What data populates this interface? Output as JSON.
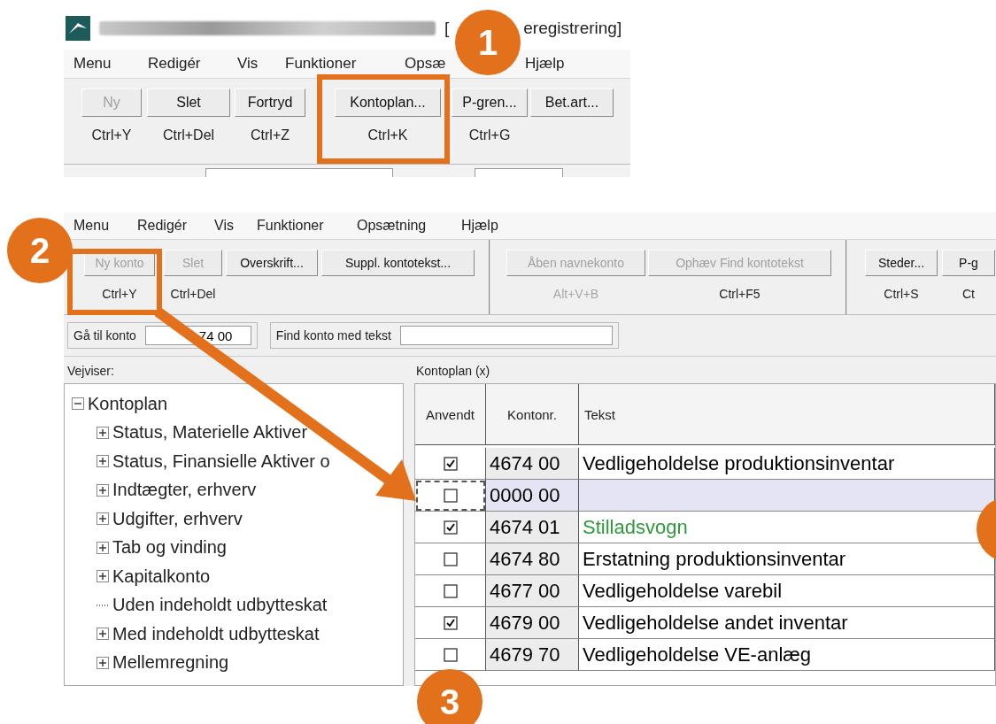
{
  "top_window": {
    "title_start": "[",
    "title_end": "eregistrering]",
    "menu": [
      "Menu",
      "Redigér",
      "Vis",
      "Funktioner",
      "Opsæ",
      "Hjælp"
    ],
    "toolbar": [
      {
        "label": "Ny",
        "disabled": true,
        "shortcut": {
          "text": "Ctrl+Y",
          "disabled": false
        }
      },
      {
        "label": "Slet",
        "disabled": false,
        "shortcut": {
          "text": "Ctrl+Del",
          "disabled": false
        }
      },
      {
        "label": "Fortryd",
        "disabled": false,
        "shortcut": {
          "text": "Ctrl+Z",
          "disabled": false
        }
      },
      {
        "label": "Kontoplan...",
        "disabled": false,
        "shortcut": {
          "text": "Ctrl+K",
          "disabled": false
        }
      },
      {
        "label": "P-gren...",
        "disabled": false,
        "shortcut": {
          "text": "Ctrl+G",
          "disabled": false
        }
      },
      {
        "label": "Bet.art...",
        "disabled": false
      }
    ]
  },
  "main_window": {
    "menu": [
      "Menu",
      "Redigér",
      "Vis",
      "Funktioner",
      "Opsætning",
      "Hjælp"
    ],
    "toolbar_groups": [
      [
        {
          "label": "Ny konto",
          "disabled": true,
          "shortcut": {
            "text": "Ctrl+Y",
            "disabled": false
          }
        },
        {
          "label": "Slet",
          "disabled": true,
          "shortcut": {
            "text": "Ctrl+Del",
            "disabled": false
          }
        },
        {
          "label": "Overskrift...",
          "disabled": false
        },
        {
          "label": "Suppl. kontotekst...",
          "disabled": false
        }
      ],
      [
        {
          "label": "Åben navnekonto",
          "disabled": true,
          "shortcut": {
            "text": "Alt+V+B",
            "disabled": true
          }
        },
        {
          "label": "Ophæv Find kontotekst",
          "disabled": true,
          "shortcut": {
            "text": "Ctrl+F5",
            "disabled": false
          }
        }
      ],
      [
        {
          "label": "Steder...",
          "disabled": false,
          "shortcut": {
            "text": "Ctrl+S",
            "disabled": false
          }
        },
        {
          "label": "P-g",
          "disabled": false,
          "shortcut": {
            "text": "Ct",
            "disabled": false
          }
        }
      ]
    ],
    "goto_label": "Gå til konto",
    "goto_value": "74 00",
    "find_label": "Find konto med tekst",
    "tree_title": "Vejviser:",
    "tree": [
      {
        "label": "Kontoplan",
        "kind": "node",
        "expanded": true,
        "children": [
          {
            "label": "Status, Materielle Aktiver",
            "kind": "node",
            "expanded": false
          },
          {
            "label": "Status, Finansielle Aktiver o",
            "kind": "node",
            "expanded": false
          },
          {
            "label": "Indtægter, erhverv",
            "kind": "node",
            "expanded": false
          },
          {
            "label": "Udgifter, erhverv",
            "kind": "node",
            "expanded": false
          },
          {
            "label": "Tab og vinding",
            "kind": "node",
            "expanded": false
          },
          {
            "label": "Kapitalkonto",
            "kind": "node",
            "expanded": false
          },
          {
            "label": "Uden indeholdt udbytteskat",
            "kind": "leaf"
          },
          {
            "label": "Med indeholdt udbytteskat",
            "kind": "node",
            "expanded": false
          },
          {
            "label": "Mellemregning",
            "kind": "node",
            "expanded": false
          }
        ]
      }
    ],
    "table_title": "Kontoplan (x)",
    "columns": [
      "Anvendt",
      "Kontonr.",
      "Tekst"
    ],
    "rows": [
      {
        "checked": true,
        "selected": false,
        "number": "4674 00",
        "text": "Vedligeholdelse produktionsinventar",
        "color": "#000000"
      },
      {
        "checked": false,
        "selected": true,
        "number": "0000 00"
      },
      {
        "checked": true,
        "selected": false,
        "number": "4674 01",
        "text": "Stilladsvogn",
        "color": "#2e9a3a"
      },
      {
        "checked": false,
        "selected": false,
        "number": "4674 80",
        "text": "Erstatning produktionsinventar",
        "color": "#000000"
      },
      {
        "checked": false,
        "selected": false,
        "number": "4677 00",
        "text": "Vedligeholdelse varebil",
        "color": "#000000"
      },
      {
        "checked": true,
        "selected": false,
        "number": "4679 00",
        "text": "Vedligeholdelse andet inventar",
        "color": "#000000"
      },
      {
        "checked": false,
        "selected": false,
        "number": "4679 70",
        "text": "Vedligeholdelse VE-anlæg",
        "color": "#000000"
      }
    ]
  },
  "annotations": [
    {
      "kind": "badge",
      "number": "1"
    },
    {
      "kind": "badge",
      "number": "2"
    },
    {
      "kind": "badge",
      "number": "3"
    },
    {
      "kind": "badge-cut"
    }
  ]
}
